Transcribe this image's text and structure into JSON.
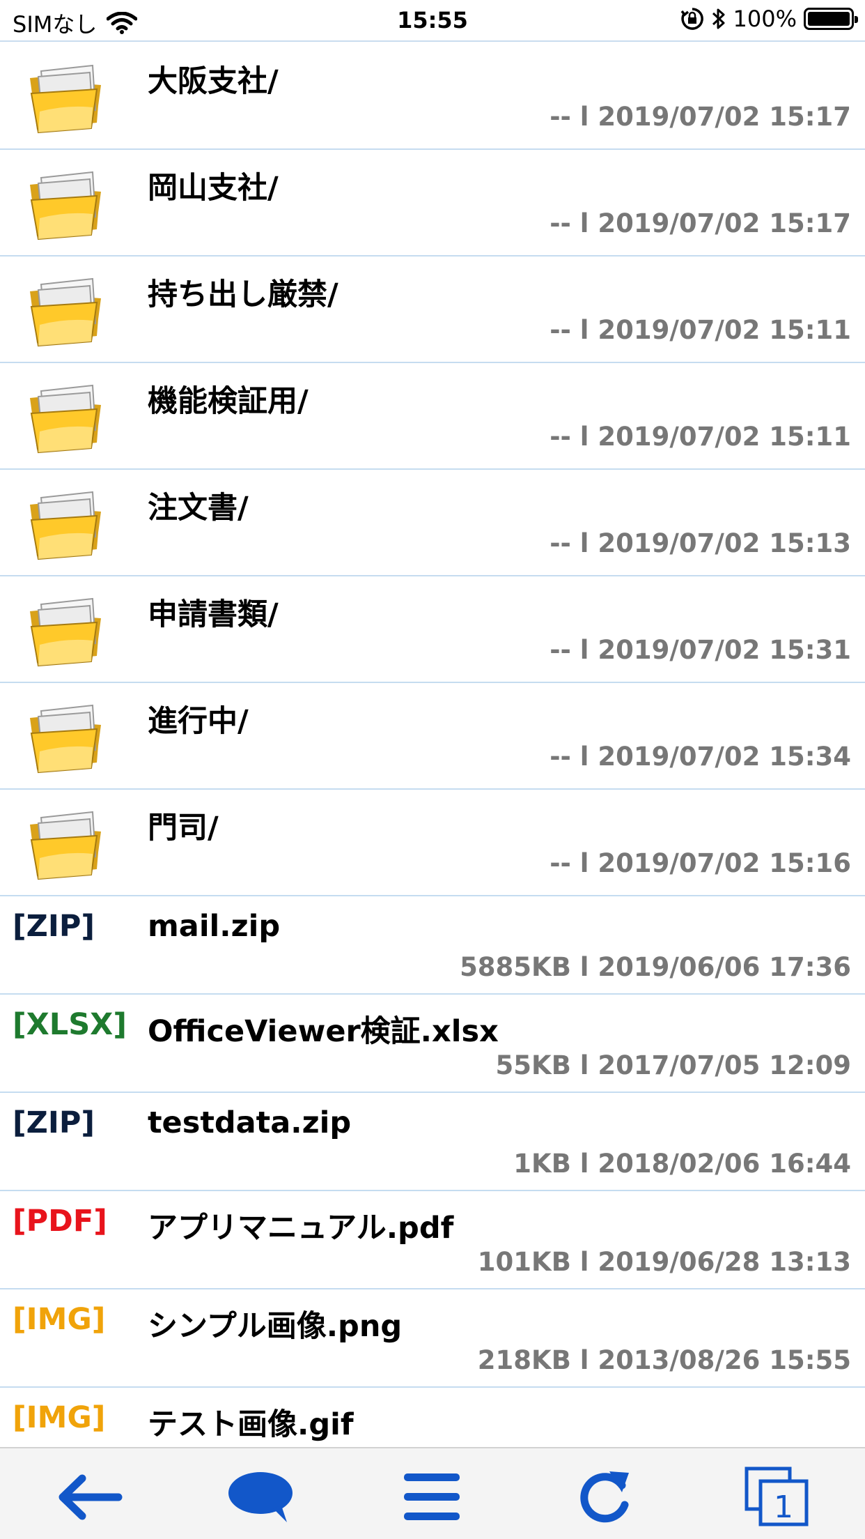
{
  "status_bar": {
    "carrier": "SIMなし",
    "time": "15:55",
    "battery": "100%"
  },
  "folders": [
    {
      "name": "大阪支社/",
      "meta": "-- l 2019/07/02 15:17"
    },
    {
      "name": "岡山支社/",
      "meta": "-- l 2019/07/02 15:17"
    },
    {
      "name": "持ち出し厳禁/",
      "meta": "-- l 2019/07/02 15:11"
    },
    {
      "name": "機能検証用/",
      "meta": "-- l 2019/07/02 15:11"
    },
    {
      "name": "注文書/",
      "meta": "-- l 2019/07/02 15:13"
    },
    {
      "name": "申請書類/",
      "meta": "-- l 2019/07/02 15:31"
    },
    {
      "name": "進行中/",
      "meta": "-- l 2019/07/02 15:34"
    },
    {
      "name": "門司/",
      "meta": "-- l 2019/07/02 15:16"
    }
  ],
  "files": [
    {
      "type": "[ZIP]",
      "type_color": "#0b1e3d",
      "name": "mail.zip",
      "meta": "5885KB l 2019/06/06 17:36"
    },
    {
      "type": "[XLSX]",
      "type_color": "#1e7a2e",
      "name": "OfficeViewer検証.xlsx",
      "meta": "55KB l 2017/07/05 12:09"
    },
    {
      "type": "[ZIP]",
      "type_color": "#0b1e3d",
      "name": "testdata.zip",
      "meta": "1KB l 2018/02/06 16:44"
    },
    {
      "type": "[PDF]",
      "type_color": "#e8141c",
      "name": "アプリマニュアル.pdf",
      "meta": "101KB l 2019/06/28 13:13"
    },
    {
      "type": "[IMG]",
      "type_color": "#f0a30a",
      "name": "シンプル画像.png",
      "meta": "218KB l 2013/08/26 15:55"
    },
    {
      "type": "[IMG]",
      "type_color": "#f0a30a",
      "name": "テスト画像.gif",
      "meta": ""
    }
  ],
  "toolbar": {
    "accent": "#1257c9",
    "tabs_count": "1",
    "buttons": [
      "back-arrow-icon",
      "chat-bubble-icon",
      "menu-icon",
      "reload-icon",
      "tabs-icon"
    ]
  }
}
